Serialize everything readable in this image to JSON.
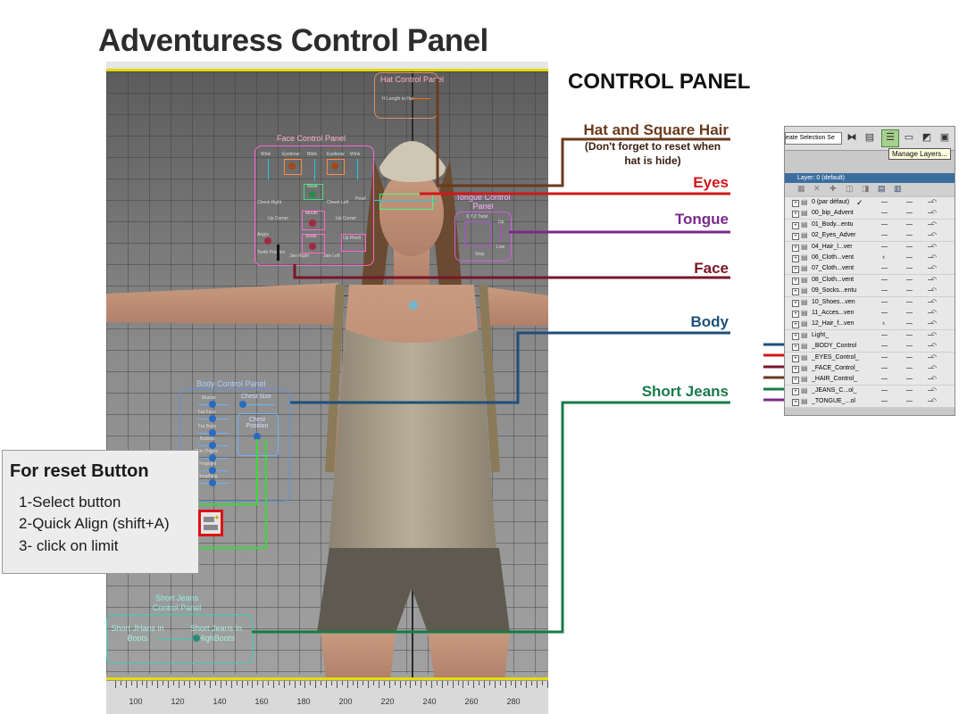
{
  "title": "Adventuress Control Panel",
  "control_panel_heading": "CONTROL PANEL",
  "viewport": {
    "timeline_labels": [
      "100",
      "120",
      "140",
      "160",
      "180",
      "200",
      "220",
      "240",
      "260",
      "280"
    ],
    "hat_panel": {
      "title": "Hat Control Panel",
      "item": "H Length to Hat"
    },
    "face_panel": {
      "title": "Face Control Panel",
      "labels": [
        "Wink",
        "Eyebrow",
        "Blink",
        "Eyebrow",
        "Wink",
        "Nose",
        "Check Right",
        "Cheek Left",
        "Pearl",
        "Up Corner",
        "Mouth",
        "Up Corner",
        "Angry",
        "Smile",
        "Up Pinch",
        "Jaw Right",
        "Jaw Left",
        "Tooth Position"
      ]
    },
    "tongue_panel": {
      "title": "Tongue Control Panel",
      "labels": [
        "X,Y,Z Twist",
        "Up",
        "Low",
        "Stop"
      ]
    },
    "body_panel": {
      "title": "Body Control Panel",
      "labels": [
        "Muscle",
        "Chest Size",
        "Fat Face",
        "Fat Body",
        "Buttock",
        "Thin Thighs",
        "Pregnant",
        "Breathing",
        "Chest Position"
      ]
    },
    "jeans_panel": {
      "title": "Short Jeans Control Panel",
      "opt1": "Short JHans in Boots",
      "opt2": "Short Jeans In HighBoots"
    }
  },
  "callouts": {
    "hat": "Hat and Square Hair",
    "hat_note": "(Don't forget to reset when hat is hide)",
    "eyes": "Eyes",
    "tongue": "Tongue",
    "face": "Face",
    "body": "Body",
    "jeans": "Short Jeans"
  },
  "colors": {
    "hat": "#6b3a1e",
    "eyes": "#d01818",
    "tongue": "#7a2a8a",
    "face": "#7a1528",
    "body": "#1e4f7a",
    "jeans": "#1a7a4a",
    "reset_line": "#3ad83a"
  },
  "layer_panel": {
    "dropdown": "eate Selection Se",
    "tooltip": "Manage Layers...",
    "header": "Layer: 0 (default)",
    "layers": [
      "0 (par défaut)",
      "00_bip_Advent",
      "01_Body...entu",
      "02_Eyes_Adver",
      "04_Hair_l...ver",
      "06_Cloth...vent",
      "07_Cloth...vent",
      "08_Cloth...vent",
      "09_Socks...entu",
      "10_Shoes...ven",
      "11_Acces...ven",
      "12_Hair_f...ven",
      "Light_",
      "_BODY_Control",
      "_EYES_Control_",
      "_FACE_Control_",
      "_HAIR_Control_",
      "_JEANS_C...ol_",
      "_TONGUE_...ol"
    ],
    "checkmark": "✓"
  },
  "reset": {
    "title": "For reset Button",
    "steps": [
      "1-Select button",
      "2-Quick Align (shift+A)",
      "3- click on limit"
    ]
  }
}
